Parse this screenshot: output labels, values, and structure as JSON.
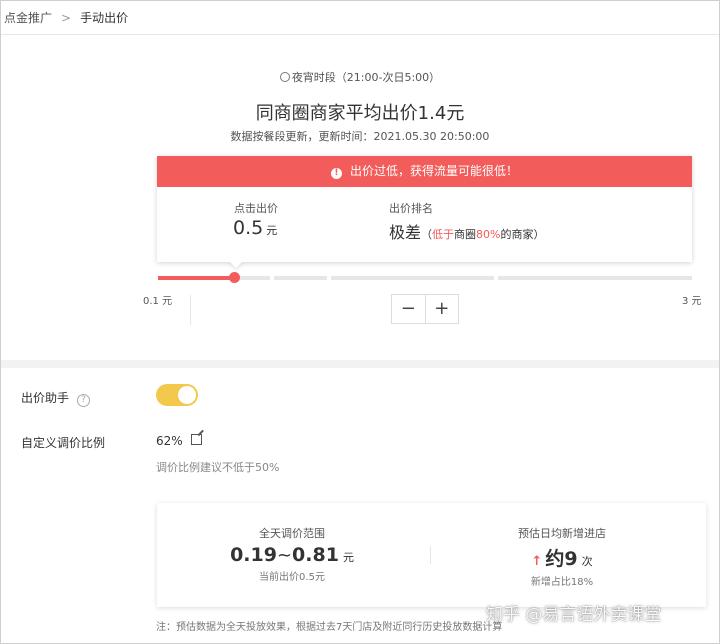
{
  "breadcrumb": {
    "parent": "点金推广",
    "separator": ">",
    "current": "手动出价"
  },
  "header": {
    "period": "夜宵时段（21:00-次日5:00）",
    "avg_bid": "同商圈商家平均出价1.4元",
    "update": "数据按餐段更新，更新时间：2021.05.30 20:50:00"
  },
  "warning_card": {
    "banner": "出价过低，获得流量可能很低！",
    "click_bid_label": "点击出价",
    "click_bid_value": "0.5",
    "click_bid_unit": "元",
    "rank_label": "出价排名",
    "rank_value": "极差",
    "rank_detail_open": "（",
    "rank_low": "低于",
    "rank_mid": "商圈",
    "rank_pct": "80%",
    "rank_tail": "的商家）"
  },
  "slider": {
    "min_label": "0.1 元",
    "max_label": "3 元",
    "progress": 0.14,
    "minus": "−",
    "plus": "+"
  },
  "assistant": {
    "label": "出价助手",
    "help": "?",
    "enabled": true
  },
  "custom_ratio": {
    "label": "自定义调价比例",
    "value": "62%",
    "hint": "调价比例建议不低于50%"
  },
  "estimate": {
    "range_title": "全天调价范围",
    "range_low": "0.19",
    "range_tilde": "~",
    "range_high": "0.81",
    "range_unit": "元",
    "range_sub": "当前出价0.5元",
    "visits_title": "预估日均新增进店",
    "visits_arrow": "↑",
    "visits_value": "约9",
    "visits_unit": "次",
    "visits_sub": "新增占比18%"
  },
  "note": "注：预估数据为全天投放效果，根据过去7天门店及附近同行历史投放数据计算",
  "watermark": "知乎 @易言语外卖课堂",
  "colors": {
    "accent": "#f25c5a",
    "toggle": "#f2c94c"
  }
}
